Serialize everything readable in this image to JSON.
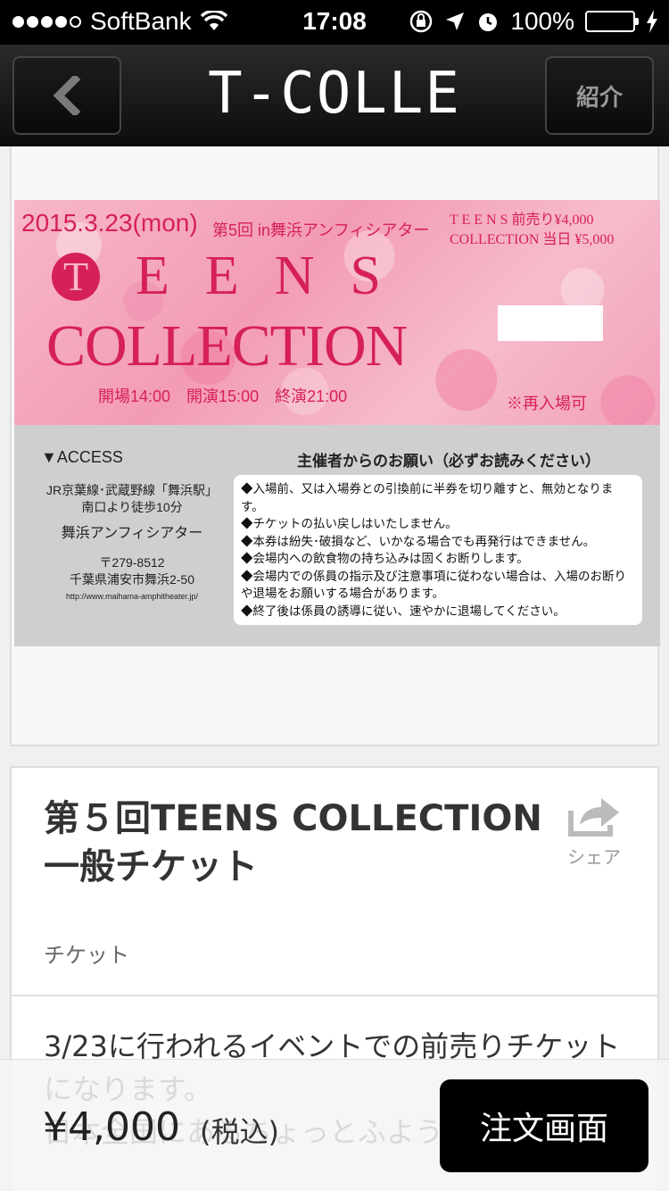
{
  "status_bar": {
    "carrier": "SoftBank",
    "time": "17:08",
    "battery": "100%",
    "battery_level": 1.0
  },
  "nav": {
    "title": "T-COLLE",
    "back_icon": "chevron-left-icon",
    "intro_label": "紹介"
  },
  "ticket_image": {
    "date": "2015.3.23(mon)",
    "venue": "第5回 in舞浜アンフィシアター",
    "price_presale": "T E E N S 前売り¥4,000",
    "price_door": "COLLECTION 当日 ¥5,000",
    "teens_initial": "T",
    "teens_rest": "EENS",
    "collection": "COLLECTION",
    "times": "開場14:00　開演15:00　終演21:00",
    "reentry": "※再入場可",
    "access_heading": "▼ACCESS",
    "access_line1": "JR京葉線･武蔵野線「舞浜駅」",
    "access_line2": "南口より徒歩10分",
    "access_venue": "舞浜アンフィシアター",
    "access_zip": "〒279-8512",
    "access_address": "千葉県浦安市舞浜2-50",
    "access_url": "http://www.maihama-amphitheater.jp/",
    "request_title": "主催者からのお願い（必ずお読みください）",
    "requests": [
      "◆入場前、又は入場券との引換前に半券を切り離すと、無効となります。",
      "◆チケットの払い戻しはいたしません。",
      "◆本券は紛失･破損など、いかなる場合でも再発行はできません。",
      "◆会場内への飲食物の持ち込みは固くお断りします。",
      "◆会場内での係員の指示及び注意事項に従わない場合は、入場のお断りや退場をお願いする場合があります。",
      "◆終了後は係員の誘導に従い、速やかに退場してください。"
    ]
  },
  "product": {
    "title": "第５回TEENS COLLECTION　一般チケット",
    "category": "チケット",
    "share_label": "シェア",
    "share_icon": "share-icon",
    "description": "3/23に行われるイベントでの前売りチケットになります。\n日本全国にあるちょっとふよう"
  },
  "purchase": {
    "price": "¥4,000",
    "tax_note": "(税込)",
    "order_label": "注文画面"
  },
  "colors": {
    "ticket_pink": "#d6205a",
    "battery_green": "#4cd964",
    "nav_dark": "#111111"
  }
}
